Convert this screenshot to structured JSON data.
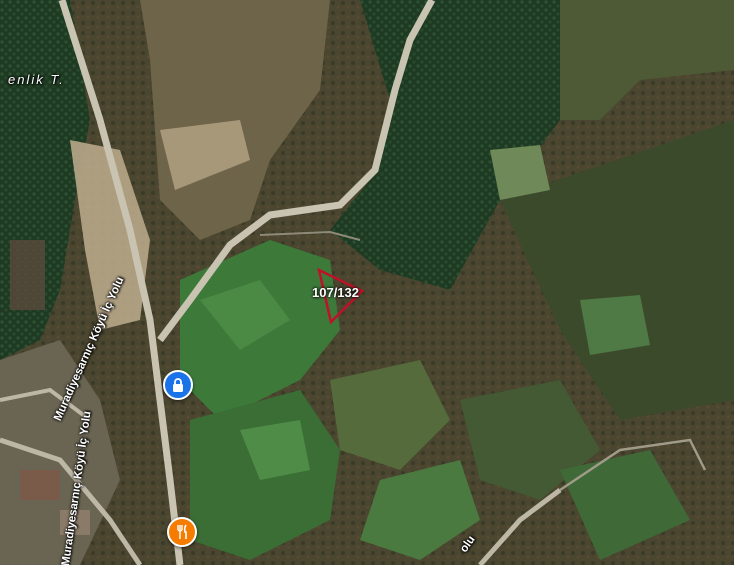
{
  "map": {
    "place_label": "enlik T.",
    "road_labels": [
      "Muradiyesarnıç Köyü İç Yolu",
      "Muradiyesarnıç Köyü İç Yolu",
      "olu"
    ],
    "parcel_label": "107/132",
    "parcel_color": "#c0102a",
    "pois": [
      {
        "icon": "lock-icon",
        "color": "#1a73e8"
      },
      {
        "icon": "restaurant-icon",
        "color": "#f57c00"
      }
    ]
  }
}
